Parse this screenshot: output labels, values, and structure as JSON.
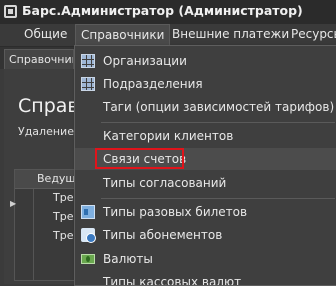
{
  "window": {
    "title": "Барс.Администратор (Администратор)"
  },
  "menubar": {
    "items": [
      "Общие",
      "Справочники",
      "Внешние платежи",
      "Ресурсы"
    ]
  },
  "tabs": [
    "Справочник"
  ],
  "page": {
    "title": "Справ",
    "subtitle": "Удаление т"
  },
  "grid": {
    "header": "Ведуща",
    "rows": [
      "Тре",
      "Тре",
      "Тре"
    ]
  },
  "dropdown": {
    "items": [
      {
        "label": "Организации",
        "icon": "grid-icon"
      },
      {
        "label": "Подразделения",
        "icon": "grid-icon"
      },
      {
        "label": "Таги (опции зависимостей тарифов)",
        "icon": ""
      },
      {
        "label": "Категории клиентов",
        "icon": ""
      },
      {
        "label": "Связи счетов",
        "icon": ""
      },
      {
        "label": "Типы согласований",
        "icon": ""
      },
      {
        "label": "Типы разовых билетов",
        "icon": "ticket-icon"
      },
      {
        "label": "Типы абонементов",
        "icon": "clock-icon"
      },
      {
        "label": "Валюты",
        "icon": "money-icon"
      },
      {
        "label": "Типы кассовых валют",
        "icon": ""
      }
    ]
  },
  "colors": {
    "highlight": "#e0141b"
  }
}
